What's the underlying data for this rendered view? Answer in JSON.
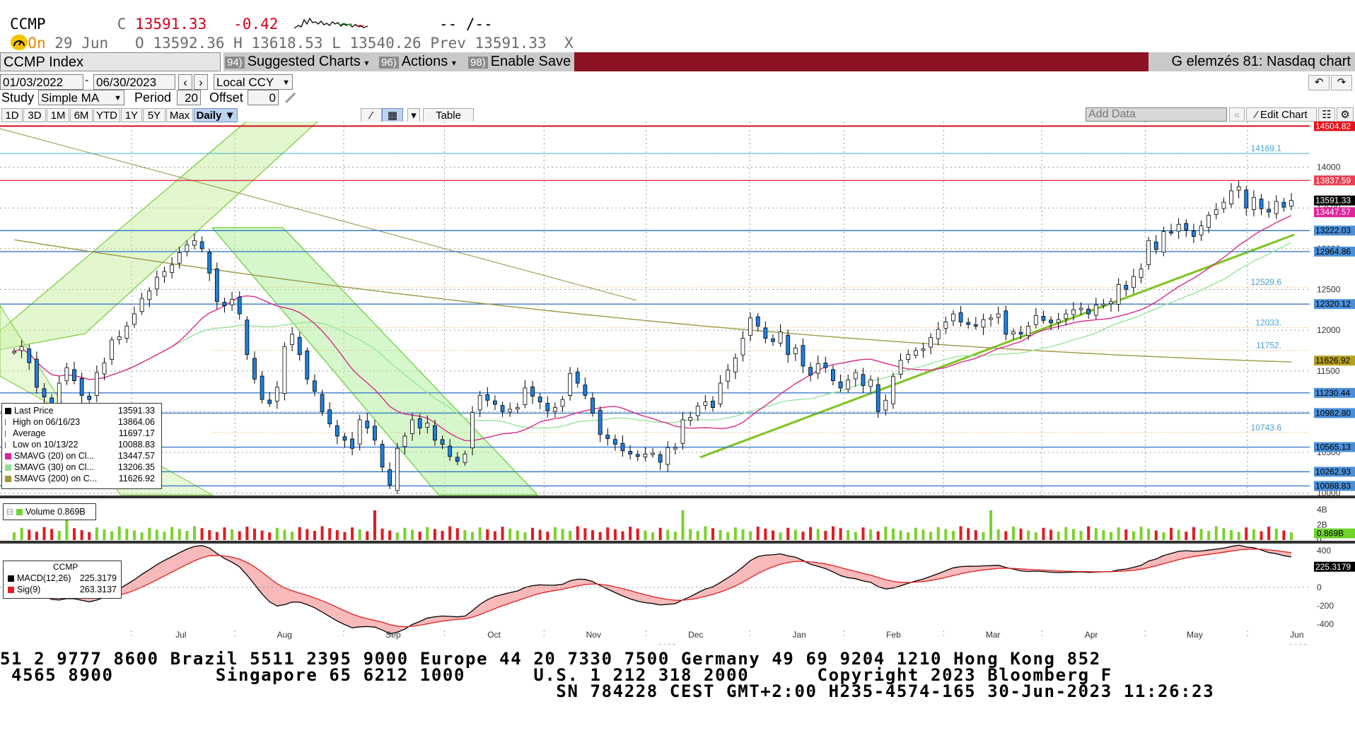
{
  "header": {
    "ticker": "CCMP",
    "close_prefix": "C",
    "close": "13591.33",
    "change": "-0.42",
    "dashes": "-- /--",
    "on_label": "On",
    "date": "29 Jun",
    "open": "O 13592.36",
    "high": "H 13618.53",
    "low": "L 13540.26",
    "prev": "Prev 13591.33",
    "close_x": "X"
  },
  "command_bar": {
    "security": "CCMP Index",
    "suggested_num": "94)",
    "suggested": "Suggested Charts",
    "actions_num": "96)",
    "actions": "Actions",
    "enable_num": "98)",
    "enable": "Enable Save",
    "title": "G elemzés 81: Nasdaq chart"
  },
  "controls": {
    "start_date": "01/03/2022",
    "end_date": "06/30/2023",
    "currency": "Local CCY",
    "study_label": "Study",
    "study_value": "Simple MA",
    "period_label": "Period",
    "period_value": "20",
    "offset_label": "Offset",
    "offset_value": "0",
    "ranges": [
      "1D",
      "3D",
      "1M",
      "6M",
      "YTD",
      "1Y",
      "5Y",
      "Max"
    ],
    "frequency": "Daily",
    "table_label": "Table",
    "add_data_placeholder": "Add Data",
    "edit_chart": "Edit Chart"
  },
  "legend": [
    {
      "label": "Last Price",
      "value": "13591.33",
      "color": "#000000"
    },
    {
      "label": "High on 06/16/23",
      "value": "13864.06",
      "color": ""
    },
    {
      "label": "Average",
      "value": "11697.17",
      "color": ""
    },
    {
      "label": "Low on 10/13/22",
      "value": "10088.83",
      "color": ""
    },
    {
      "label": "SMAVG (20)  on Cl...",
      "value": "13447.57",
      "color": "#e0249a"
    },
    {
      "label": "SMAVG (30)  on Cl...",
      "value": "13206.35",
      "color": "#8fe08f"
    },
    {
      "label": "SMAVG (200)  on C...",
      "value": "11626.92",
      "color": "#9a9a3a"
    }
  ],
  "volume_legend": {
    "label": "Volume 0.869B"
  },
  "macd_legend": {
    "title": "CCMP",
    "rows": [
      {
        "label": "MACD(12,26)",
        "value": "225.3179",
        "color": "#000000"
      },
      {
        "label": "Sig(9)",
        "value": "263.3137",
        "color": "#e02020"
      }
    ]
  },
  "price_tags": [
    {
      "text": "14504.82",
      "y": 14504.82,
      "bg": "#e8101a",
      "fg": "#ffffff"
    },
    {
      "text": "13837.59",
      "y": 13837.59,
      "bg": "#e84050",
      "fg": "#ffffff"
    },
    {
      "text": "13591.33",
      "y": 13591.33,
      "bg": "#000000",
      "fg": "#ffffff"
    },
    {
      "text": "13447.57",
      "y": 13447.57,
      "bg": "#e0249a",
      "fg": "#ffffff"
    },
    {
      "text": "13222.03",
      "y": 13222.03,
      "bg": "#4a90d9",
      "fg": "#000000"
    },
    {
      "text": "12964.86",
      "y": 12964.86,
      "bg": "#4a90d9",
      "fg": "#000000"
    },
    {
      "text": "12320.12",
      "y": 12320.12,
      "bg": "#4a90d9",
      "fg": "#000000"
    },
    {
      "text": "11626.92",
      "y": 11626.92,
      "bg": "#b5a020",
      "fg": "#000000"
    },
    {
      "text": "11230.44",
      "y": 11230.44,
      "bg": "#4a90d9",
      "fg": "#000000"
    },
    {
      "text": "10982.80",
      "y": 10982.8,
      "bg": "#4a90d9",
      "fg": "#000000"
    },
    {
      "text": "10565.13",
      "y": 10565.13,
      "bg": "#4a90d9",
      "fg": "#000000"
    },
    {
      "text": "10262.93",
      "y": 10262.93,
      "bg": "#4a90d9",
      "fg": "#000000"
    },
    {
      "text": "10088.83",
      "y": 10088.83,
      "bg": "#4a90d9",
      "fg": "#000000"
    }
  ],
  "fib_labels": [
    {
      "text": "14169.1",
      "y": 14169.1
    },
    {
      "text": "12529.6",
      "y": 12529.6
    },
    {
      "text": "12033.",
      "y": 12033
    },
    {
      "text": "11752.",
      "y": 11752
    },
    {
      "text": "10743.6",
      "y": 10743.6
    }
  ],
  "volume_tags": [
    {
      "text": "0.869B"
    }
  ],
  "volume_ticks": [
    {
      "text": "4B",
      "v": 4
    },
    {
      "text": "2B",
      "v": 2
    },
    {
      "text": "0",
      "v": 0
    }
  ],
  "macd_tags": [
    {
      "text": "225.3179",
      "v": 225.3179
    }
  ],
  "macd_ticks": [
    {
      "text": "400",
      "v": 400
    },
    {
      "text": "200",
      "v": 200
    },
    {
      "text": "0",
      "v": 0
    },
    {
      "text": "-200",
      "v": -200
    },
    {
      "text": "-400",
      "v": -400
    }
  ],
  "x_months": [
    {
      "label": "Jul",
      "t": 0.068
    },
    {
      "label": "Aug",
      "t": 0.147
    },
    {
      "label": "Sep",
      "t": 0.23
    },
    {
      "label": "Oct",
      "t": 0.307
    },
    {
      "label": "Nov",
      "t": 0.383
    },
    {
      "label": "Dec",
      "t": 0.461
    },
    {
      "label": "Jan",
      "t": 0.54
    },
    {
      "label": "Feb",
      "t": 0.612
    },
    {
      "label": "Mar",
      "t": 0.688
    },
    {
      "label": "Apr",
      "t": 0.763
    },
    {
      "label": "May",
      "t": 0.842
    },
    {
      "label": "Jun",
      "t": 0.92
    }
  ],
  "x_years": [
    {
      "label": "2022",
      "t": 0.25
    },
    {
      "label": "2023",
      "t": 0.732
    }
  ],
  "ticker_lines": [
    "51 2 9777 8600 Brazil 5511 2395 9000 Europe 44 20 7330 7500 Germany 49 69 9204 1210 Hong Kong 852",
    " 4565 8900         Singapore 65 6212 1000      U.S. 1 212 318 2000      Copyright 2023 Bloomberg F",
    "                                                 SN 784228 CEST GMT+2:00 H235-4574-165 30-Jun-2023 11:26:23"
  ],
  "chart_data": {
    "type": "candlestick",
    "title": "CCMP Index",
    "y_ticks": [
      10000,
      10500,
      11000,
      11500,
      12000,
      12500,
      13000,
      13500,
      14000
    ],
    "y_tick_labels": [
      "10000",
      "10500",
      "11000",
      "11500",
      "12000",
      "12500",
      "13000",
      "13500",
      "14000"
    ],
    "ylim": [
      9980,
      14560
    ],
    "x_range": [
      "2022-05-25",
      "2023-06-30"
    ],
    "grid": true,
    "horizontal_levels": [
      14504.82,
      13837.59,
      13222.03,
      12964.86,
      12320.12,
      11230.44,
      10982.8,
      10565.13,
      10262.93,
      10088.83
    ],
    "fib_levels": [
      14169.1,
      12529.6,
      12033,
      11752,
      10743.6
    ],
    "close_series": [
      11740,
      11800,
      11600,
      11300,
      11180,
      11100,
      11350,
      11540,
      11380,
      11200,
      11150,
      11480,
      11600,
      11880,
      11920,
      12050,
      12200,
      12390,
      12480,
      12650,
      12720,
      12800,
      12950,
      13050,
      13100,
      13000,
      12700,
      12350,
      12300,
      12380,
      12200,
      11700,
      11400,
      11150,
      11100,
      11300,
      11800,
      11950,
      11700,
      11400,
      11250,
      11000,
      10850,
      10700,
      10650,
      10550,
      10900,
      10800,
      10650,
      10320,
      10100,
      10550,
      10700,
      10900,
      10800,
      10860,
      10650,
      10600,
      10450,
      10390,
      10480,
      10990,
      11200,
      11140,
      11090,
      11000,
      11030,
      11050,
      11290,
      11190,
      11120,
      11010,
      11050,
      11150,
      11470,
      11350,
      11200,
      10980,
      10720,
      10670,
      10600,
      10520,
      10480,
      10450,
      10480,
      10490,
      10380,
      10560,
      10560,
      10900,
      10930,
      11070,
      11120,
      11050,
      11350,
      11510,
      11660,
      11900,
      12150,
      12050,
      11900,
      11860,
      11980,
      11700,
      11780,
      11560,
      11450,
      11590,
      11540,
      11380,
      11290,
      11390,
      11480,
      11320,
      11390,
      11000,
      11140,
      11430,
      11630,
      11700,
      11750,
      11770,
      11910,
      12010,
      12100,
      12200,
      12100,
      12070,
      12050,
      12130,
      12150,
      12200,
      11950,
      11980,
      11950,
      12050,
      12180,
      12120,
      12090,
      12130,
      12200,
      12250,
      12270,
      12200,
      12310,
      12320,
      12350,
      12560,
      12500,
      12660,
      12750,
      13100,
      12990,
      13210,
      13200,
      13300,
      13230,
      13150,
      13280,
      13410,
      13480,
      13570,
      13710,
      13760,
      13500,
      13630,
      13490,
      13450,
      13580,
      13510,
      13591.33
    ],
    "series": [
      {
        "name": "SMAVG (20)  on Cl...",
        "last": 13447.57
      },
      {
        "name": "SMAVG (30)  on Cl...",
        "last": 13206.35
      },
      {
        "name": "SMAVG (200)  on C...",
        "last": 11626.92
      }
    ],
    "volume_last_b": 0.869,
    "macd_last": 225.3179,
    "signal_last": 263.3137
  }
}
